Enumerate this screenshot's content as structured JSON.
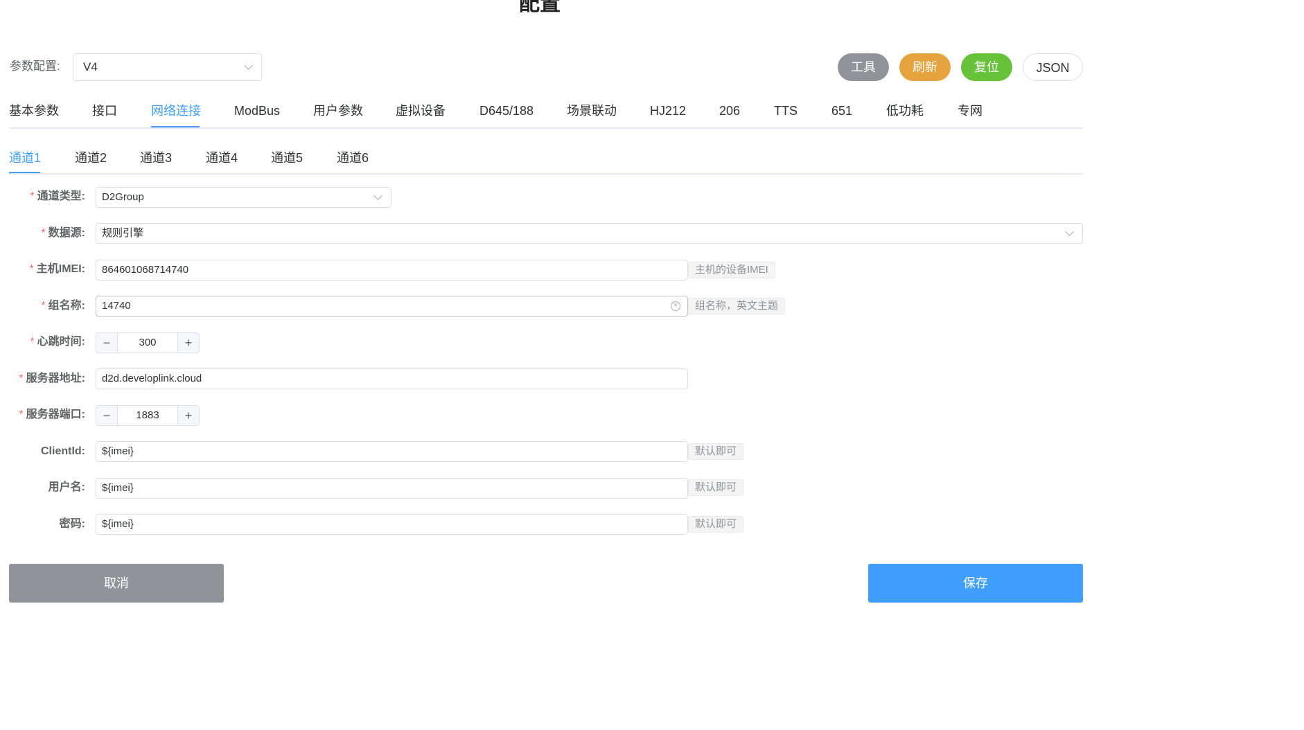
{
  "page": {
    "title": "配置"
  },
  "param_config": {
    "label": "参数配置:",
    "value": "V4"
  },
  "actions": {
    "tools": "工具",
    "refresh": "刷新",
    "reset": "复位",
    "json": "JSON"
  },
  "colors": {
    "accent": "#409eff",
    "tools": "#909399",
    "refresh": "#e6a23c",
    "reset": "#67c23a",
    "required": "#f56c6c"
  },
  "main_tabs": [
    {
      "label": "基本参数"
    },
    {
      "label": "接口"
    },
    {
      "label": "网络连接"
    },
    {
      "label": "ModBus"
    },
    {
      "label": "用户参数"
    },
    {
      "label": "虚拟设备"
    },
    {
      "label": "D645/188"
    },
    {
      "label": "场景联动"
    },
    {
      "label": "HJ212"
    },
    {
      "label": "206"
    },
    {
      "label": "TTS"
    },
    {
      "label": "651"
    },
    {
      "label": "低功耗"
    },
    {
      "label": "专网"
    }
  ],
  "active_main_tab": "网络连接",
  "channel_tabs": [
    {
      "label": "通道1"
    },
    {
      "label": "通道2"
    },
    {
      "label": "通道3"
    },
    {
      "label": "通道4"
    },
    {
      "label": "通道5"
    },
    {
      "label": "通道6"
    }
  ],
  "active_channel_tab": "通道1",
  "form": {
    "required_mark": "*",
    "channel_type": {
      "label": "通道类型:",
      "value": "D2Group"
    },
    "data_source": {
      "label": "数据源:",
      "value": "规则引擎"
    },
    "host_imei": {
      "label": "主机IMEI:",
      "value": "864601068714740",
      "hint": "主机的设备IMEI"
    },
    "group_name": {
      "label": "组名称:",
      "value": "14740",
      "hint": "组名称，英文主题"
    },
    "heartbeat": {
      "label": "心跳时间:",
      "value": "300"
    },
    "server_address": {
      "label": "服务器地址:",
      "value": "d2d.developlink.cloud"
    },
    "server_port": {
      "label": "服务器端口:",
      "value": "1883"
    },
    "client_id": {
      "label": "ClientId:",
      "value": "${imei}",
      "hint": "默认即可"
    },
    "username": {
      "label": "用户名:",
      "value": "${imei}",
      "hint": "默认即可"
    },
    "password": {
      "label": "密码:",
      "value": "${imei}",
      "hint": "默认即可"
    },
    "stepper_minus": "−",
    "stepper_plus": "+",
    "clear_glyph": "×"
  },
  "footer": {
    "cancel": "取消",
    "save": "保存"
  }
}
